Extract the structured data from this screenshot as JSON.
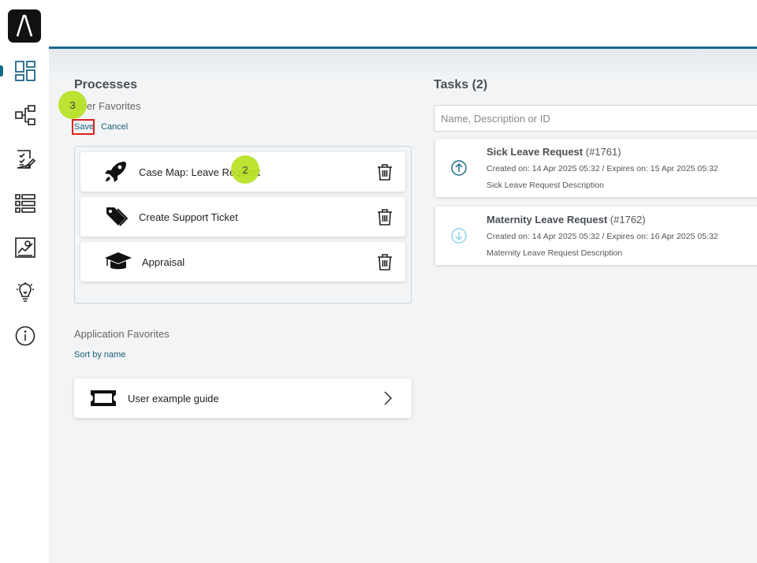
{
  "sidebar": {
    "icons": [
      {
        "name": "dashboard-icon",
        "active": true
      },
      {
        "name": "processes-icon"
      },
      {
        "name": "tasks-icon"
      },
      {
        "name": "list-icon"
      },
      {
        "name": "statistics-icon"
      },
      {
        "name": "ideas-icon"
      },
      {
        "name": "info-icon"
      }
    ],
    "accent_color": "#0e6a8a"
  },
  "processes": {
    "title": "Processes",
    "user_favorites_label": "User Favorites",
    "save_label": "Save",
    "cancel_label": "Cancel",
    "favorites": [
      {
        "label": "Case Map: Leave Request",
        "icon": "rocket-icon"
      },
      {
        "label": "Create Support Ticket",
        "icon": "tags-icon"
      },
      {
        "label": "Appraisal",
        "icon": "graduation-cap-icon"
      }
    ],
    "application_favorites_label": "Application Favorites",
    "sort_label": "Sort by name",
    "apps": [
      {
        "label": "User example guide",
        "icon": "ticket-icon"
      }
    ]
  },
  "tasks": {
    "title": "Tasks (2)",
    "search_placeholder": "Name, Description or ID",
    "items": [
      {
        "name": "Sick Leave Request",
        "id": "(#1761)",
        "dates": "Created on: 14 Apr 2025 05:32 / Expires on: 15 Apr 2025 05:32",
        "description": "Sick Leave Request Description",
        "priority_icon": "arrow-up-circle-icon"
      },
      {
        "name": "Maternity Leave Request",
        "id": "(#1762)",
        "dates": "Created on: 14 Apr 2025 05:32 / Expires on: 16 Apr 2025 05:32",
        "description": "Maternity Leave Request Description",
        "priority_icon": "arrow-down-circle-icon"
      }
    ]
  },
  "markers": {
    "step2": "2",
    "step3": "3"
  }
}
